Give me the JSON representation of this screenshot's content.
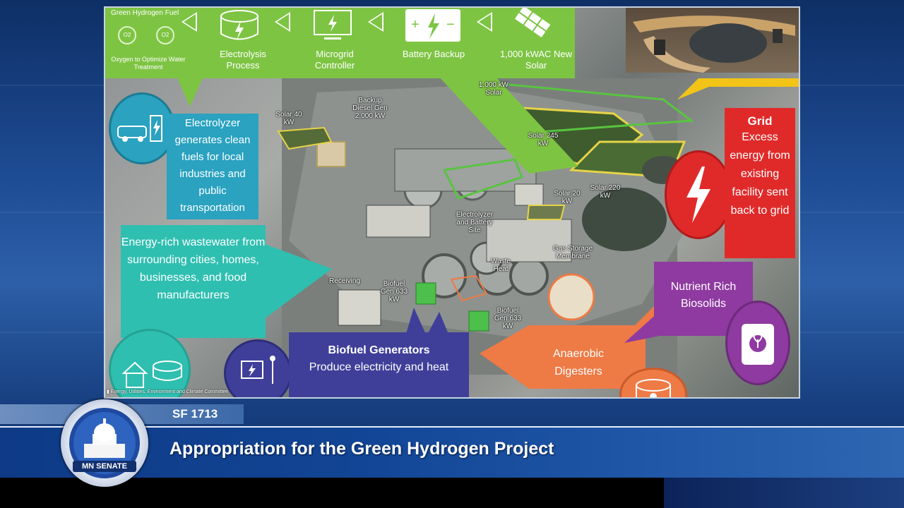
{
  "slide": {
    "top_items": [
      {
        "label": "Green Hydrogen Fuel",
        "icon": "leaf-icon"
      },
      {
        "label": "Oxygen to Optimize Water Treatment",
        "icon": "oxygen-bubbles-icon"
      },
      {
        "label": "Electrolysis Process",
        "icon": "electrolysis-tank-icon"
      },
      {
        "label": "Microgrid Controller",
        "icon": "monitor-icon"
      },
      {
        "label": "Battery Backup",
        "icon": "battery-icon"
      },
      {
        "label": "1,000 kWAC New Solar",
        "icon": "solar-panel-icon"
      }
    ],
    "o2_a": "O2",
    "o2_b": "O2",
    "callouts": {
      "electrolyzer": "Electrolyzer generates clean fuels for local industries and public transportation",
      "wastewater": "Energy-rich wastewater from surrounding cities, homes, businesses, and food manufacturers",
      "biofuel_title": "Biofuel Generators",
      "biofuel_text": "Produce electricity and heat",
      "anaerobic": "Anaerobic Digesters",
      "nutrient": "Nutrient Rich Biosolids",
      "grid_title": "Grid",
      "grid_text": "Excess energy from existing facility sent back to grid"
    },
    "map_labels": {
      "solar_1000": "1,000 kW Solar",
      "solar_40": "Solar 40 kW",
      "backup_diesel": "Backup Diesel Gen 2,000 kW",
      "solar_245": "Solar 245 kW",
      "solar_20": "Solar 20 kW",
      "solar_220": "Solar 220 kW",
      "electrolyzer_site": "Electrolyzer and Battery Site",
      "gas_storage": "Gas Storage Membrane",
      "waste_heat": "Waste Heat",
      "receiving": "Receiving",
      "biofuel_gen_1": "Biofuel Gen 633 kW",
      "biofuel_gen_2": "Biofuel Gen 633 kW"
    },
    "committee_watermark": "Energy, Utilities, Environment and Climate Committee"
  },
  "lower_third": {
    "bill": "SF 1713",
    "title": "Appropriation for the Green Hydrogen Project",
    "seal_text": "MN SENATE"
  },
  "colors": {
    "green": "#7ec443",
    "teal": "#2fbfb0",
    "navy": "#3f3f9a",
    "orange": "#ee7a45",
    "purple": "#8e3aa0",
    "red": "#e02a2a"
  }
}
